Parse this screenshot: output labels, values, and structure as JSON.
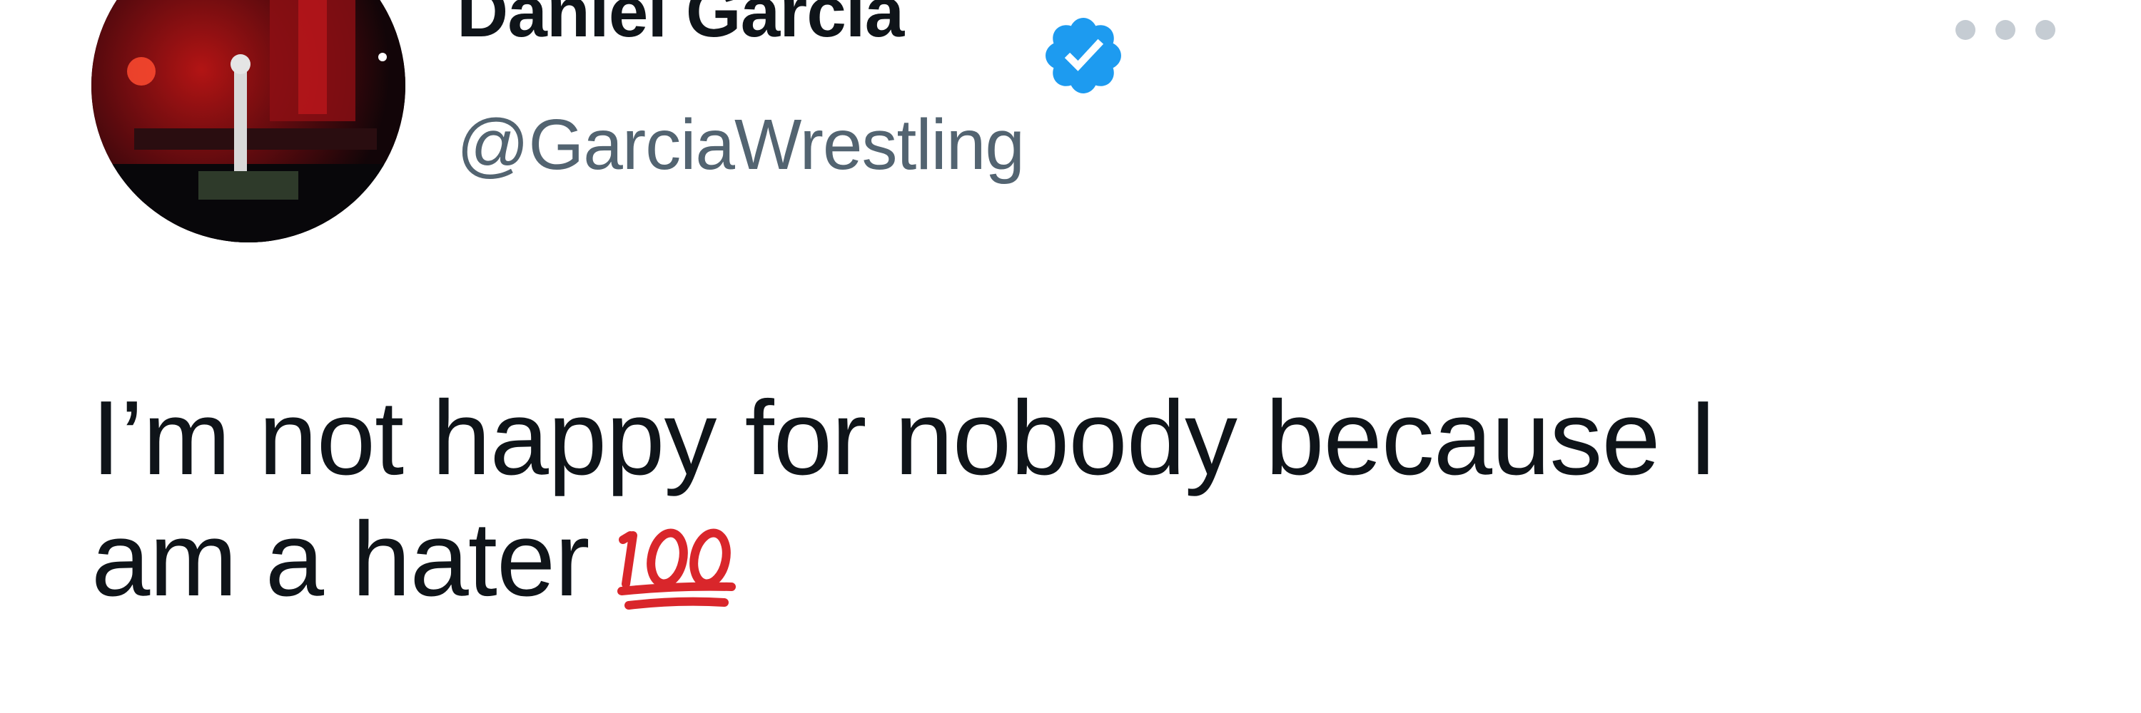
{
  "tweet": {
    "author": {
      "display_name": "Daniel Garcia",
      "handle": "@GarciaWrestling",
      "verified": true,
      "verified_icon": "verified-badge-icon"
    },
    "text_lines": [
      "I’m not happy for nobody because I",
      "am a hater"
    ],
    "emoji": "hundred-points-emoji",
    "more_icon": "more-options-icon"
  },
  "colors": {
    "name": "#0f1419",
    "handle": "#536471",
    "verified": "#1d9bf0",
    "emoji_red": "#d9262b"
  }
}
